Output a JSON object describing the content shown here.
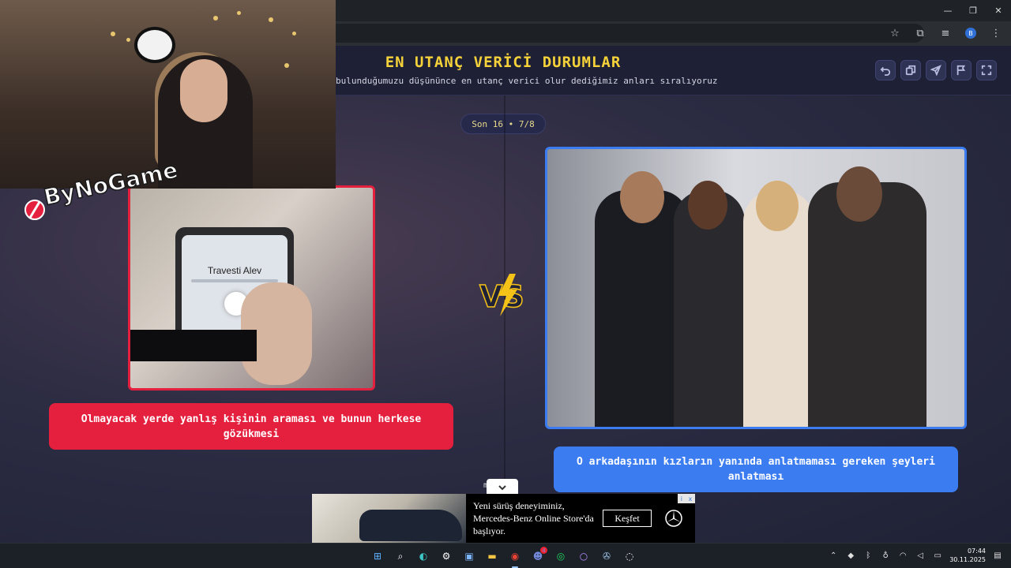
{
  "window": {
    "minimize_icon": "minimize-icon",
    "maximize_icon": "restore-icon",
    "close_icon": "close-icon"
  },
  "toolbar": {
    "profile_initial": "B",
    "icons": [
      "bookmark-star-icon",
      "extensions-icon",
      "media-controls-icon",
      "profile-icon",
      "menu-icon"
    ]
  },
  "page": {
    "title": "EN UTANÇ VERİCİ DURUMLAR",
    "subtitle": "bulunduğumuzu düşününce en utanç verici olur dediğimiz anları sıralıyoruz",
    "actions": [
      "undo-icon",
      "copy-icon",
      "share-icon",
      "flag-icon",
      "fullscreen-icon"
    ],
    "round_label": "Son 16 • 7/8",
    "left_option": {
      "phone_caller": "Travesti Alev",
      "caption": "Olmayacak yerde yanlış kişinin araması ve bunun herkese gözükmesi",
      "accent": "#e5203f"
    },
    "right_option": {
      "caption": "O arkadaşının kızların yanında anlatmaması gereken şeyleri anlatması",
      "accent": "#3b7cf0"
    },
    "vs_label": "VS",
    "under_text": "m       h"
  },
  "overlay": {
    "logo_text": "ByNoGame"
  },
  "ad": {
    "text": "Yeni sürüş deneyiminiz, Mercedes-Benz Online Store'da başlıyor.",
    "cta": "Keşfet",
    "close_labels": [
      "i",
      "x"
    ]
  },
  "taskbar": {
    "apps": [
      "windows-start-icon",
      "search-icon",
      "edge-icon",
      "settings-icon",
      "store-icon",
      "file-explorer-icon",
      "chrome-icon",
      "discord-icon",
      "spotify-icon",
      "app-icon",
      "steam-icon",
      "obs-icon"
    ],
    "discord_badge": "4",
    "time": "07:44",
    "date": "30.11.2025"
  }
}
